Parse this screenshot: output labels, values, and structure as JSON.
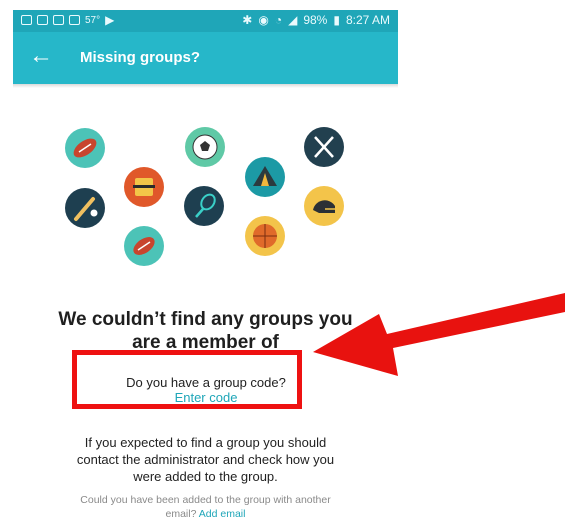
{
  "status_bar": {
    "temperature": "57°",
    "battery": "98%",
    "time": "8:27 AM"
  },
  "app_bar": {
    "title": "Missing groups?",
    "back_icon": "arrow-left"
  },
  "message": {
    "headline_line1": "We couldn’t find any groups you",
    "headline_line2": "are a member of"
  },
  "group_code": {
    "question": "Do you have a group code?",
    "link": "Enter code"
  },
  "info": {
    "line1": "If you expected to find a group you should",
    "line2": "contact the administrator and check how you",
    "line3": "were added to the group."
  },
  "email_prompt": {
    "line1": "Could you have been added to the group with another",
    "line2_prefix": "email?",
    "link": "Add email"
  },
  "colors": {
    "teal": "#26b7c9",
    "annotation_red": "#ee1111"
  },
  "illustration_icons": [
    "football-icon",
    "karate-icon",
    "soccer-ball-icon",
    "camping-tent-icon",
    "hockey-sticks-icon",
    "baseball-bat-icon",
    "tennis-racket-icon",
    "rugby-ball-icon",
    "basketball-icon",
    "football-helmet-icon"
  ]
}
